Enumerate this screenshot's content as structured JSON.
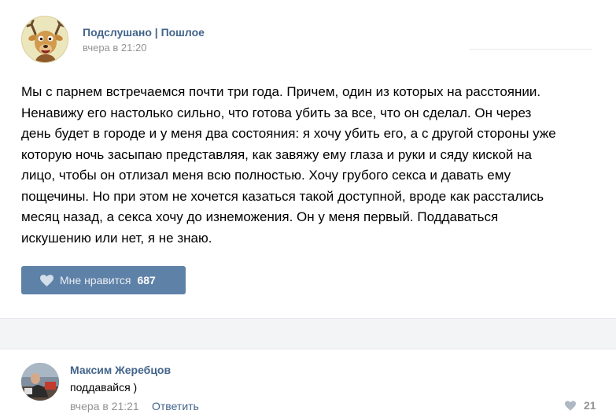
{
  "post": {
    "group_name": "Подслушано | Пошлое",
    "time": "вчера в 21:20",
    "text_lines": [
      "Мы с парнем встречаемся почти три года. Причем, один из которых на расстоянии.",
      "Ненавижу его настолько сильно, что готова убить за все, что он сделал. Он через",
      "день будет в городе и у меня два состояния: я хочу убить его, а с другой стороны уже",
      "которую ночь засыпаю представляя, как завяжу ему глаза и руки и сяду киской на",
      "лицо, чтобы он отлизал меня всю полностью. Хочу грубого секса и давать ему",
      "пощечины. Но при этом не хочется казаться такой доступной, вроде как расстались",
      "месяц назад, а секса хочу до изнеможения. Он у меня первый. Поддаваться",
      "искушению или нет, я не знаю."
    ],
    "like_label": "Мне нравится",
    "like_count": "687"
  },
  "comment": {
    "author": "Максим Жеребцов",
    "text": "поддавайся )",
    "time": "вчера в 21:21",
    "reply_label": "Ответить",
    "like_count": "21"
  },
  "icons": {
    "group_avatar": "deer-cartoon-avatar",
    "like": "heart-icon",
    "comment_like": "heart-icon"
  },
  "colors": {
    "link": "#42648b",
    "like_button": "#5e81a8",
    "muted": "#939393"
  }
}
